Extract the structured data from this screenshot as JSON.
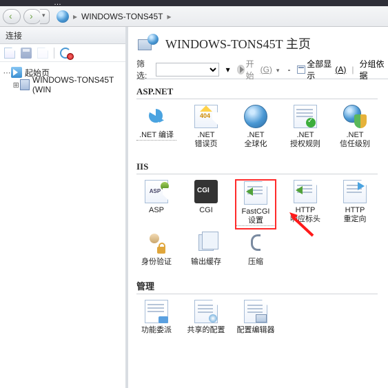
{
  "topfrag": "…",
  "breadcrumb": {
    "host": "WINDOWS-TONS45T"
  },
  "leftpane": {
    "header": "连接",
    "tree": {
      "start": "起始页",
      "server": "WINDOWS-TONS45T (WIN"
    }
  },
  "rightpane": {
    "title": "WINDOWS-TONS45T 主页",
    "filter": {
      "label": "筛选:",
      "start": "开始",
      "start_key": "(G)",
      "showall": "全部显示",
      "showall_key": "(A)",
      "groupby": "分组依据"
    },
    "groups": {
      "aspnet": {
        "title": "ASP.NET",
        "items": [
          {
            "key": "compile",
            "label": ".NET 编译"
          },
          {
            "key": "err",
            "label": ".NET 错误页"
          },
          {
            "key": "glob",
            "label": ".NET 全球化"
          },
          {
            "key": "authz",
            "label": ".NET 授权规则"
          },
          {
            "key": "trust",
            "label": ".NET 信任级别"
          }
        ]
      },
      "iis": {
        "title": "IIS",
        "items": [
          {
            "key": "asp",
            "label": "ASP"
          },
          {
            "key": "cgi",
            "label": "CGI"
          },
          {
            "key": "fcgi",
            "label": "FastCGI 设置",
            "selected": true
          },
          {
            "key": "http",
            "label": "HTTP 响应标头"
          },
          {
            "key": "redir",
            "label": "HTTP 重定向"
          },
          {
            "key": "id",
            "label": "身份验证"
          },
          {
            "key": "cache",
            "label": "输出缓存"
          },
          {
            "key": "gzip",
            "label": "压缩"
          }
        ]
      },
      "mgmt": {
        "title": "管理",
        "items": [
          {
            "key": "deleg",
            "label": "功能委派"
          },
          {
            "key": "shared",
            "label": "共享的配置"
          },
          {
            "key": "editor",
            "label": "配置编辑器"
          }
        ]
      }
    }
  }
}
